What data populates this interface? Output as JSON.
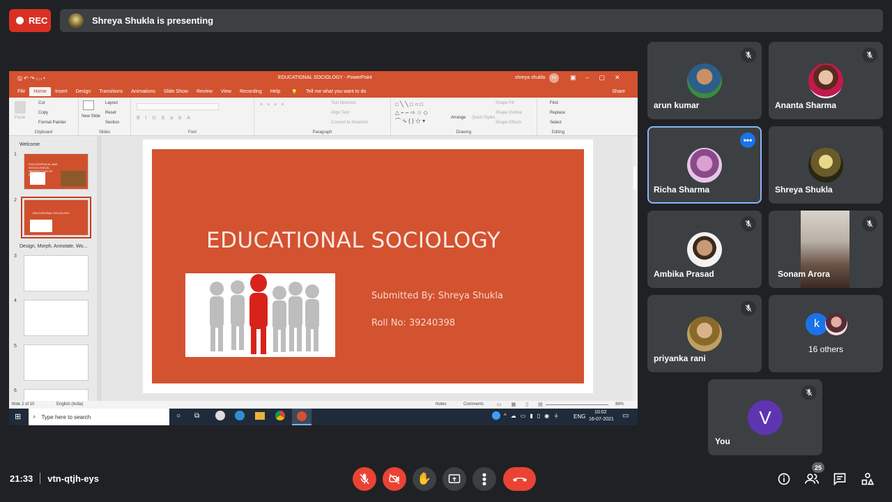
{
  "topbar": {
    "rec_label": "REC",
    "presenting_text": "Shreya Shukla is presenting"
  },
  "presentation": {
    "window_title": "EDUCATIONAL SOCIOLOGY - PowerPoint",
    "user": "shreya shukla",
    "user_initials": "SS",
    "tabs": [
      "File",
      "Home",
      "Insert",
      "Design",
      "Transitions",
      "Animations",
      "Slide Show",
      "Review",
      "View",
      "Recording",
      "Help"
    ],
    "tell_me": "Tell me what you want to do",
    "share": "Share",
    "ribbon": {
      "clipboard": {
        "label": "Clipboard",
        "paste": "Paste",
        "cut": "Cut",
        "copy": "Copy",
        "format_painter": "Format Painter"
      },
      "slides": {
        "label": "Slides",
        "new_slide": "New Slide",
        "layout": "Layout",
        "reset": "Reset",
        "section": "Section"
      },
      "font": {
        "label": "Font"
      },
      "paragraph": {
        "label": "Paragraph",
        "text_direction": "Text Direction",
        "align_text": "Align Text",
        "convert": "Convert to SmartArt"
      },
      "drawing": {
        "label": "Drawing",
        "arrange": "Arrange",
        "quick_styles": "Quick Styles",
        "shape_fill": "Shape Fill",
        "shape_outline": "Shape Outline",
        "shape_effects": "Shape Effects"
      },
      "editing": {
        "label": "Editing",
        "find": "Find",
        "replace": "Replace",
        "select": "Select"
      }
    },
    "sections": {
      "welcome": "Welcome",
      "design": "Design, Morph, Annotate, Wo..."
    },
    "thumb_numbers": [
      "1",
      "2",
      "3",
      "4",
      "5",
      "6"
    ],
    "thumb1_text": "PHILOSOPHICAL AND SOCIOLOGICAL PERSPECTIVE OF EDUCATION",
    "thumb2_text": "EDUCATIONAL SOCIOLOGY",
    "slide": {
      "title": "EDUCATIONAL SOCIOLOGY",
      "submitted_by": "Submitted By: Shreya Shukla",
      "roll_no": "Roll No: 39240398"
    },
    "status": {
      "slide_of": "Slide 2 of 10",
      "language": "English (India)",
      "notes": "Notes",
      "comments": "Comments",
      "zoom": "86%"
    },
    "taskbar": {
      "search": "Type here to search",
      "lang": "ENG",
      "time": "10:02",
      "date": "16-07-2021"
    }
  },
  "participants": [
    {
      "name": "arun kumar",
      "muted": true
    },
    {
      "name": "Ananta Sharma",
      "muted": true
    },
    {
      "name": "Richa Sharma",
      "muted": false
    },
    {
      "name": "Shreya Shukla",
      "muted": false
    },
    {
      "name": "Ambika Prasad",
      "muted": true
    },
    {
      "name": "Sonam Arora",
      "muted": true
    },
    {
      "name": "priyanka rani",
      "muted": true
    },
    {
      "name": "16 others",
      "initial": "k"
    },
    {
      "name": "You",
      "initial": "V",
      "muted": true
    }
  ],
  "bottom": {
    "time": "21:33",
    "meeting_code": "vtn-qtjh-eys",
    "people_count": "25"
  },
  "colors": {
    "accent": "#d35230",
    "red": "#ea4335",
    "tile": "#3c4043",
    "bg": "#202124",
    "you_avatar": "#5e35b1",
    "k_avatar": "#1a73e8"
  }
}
